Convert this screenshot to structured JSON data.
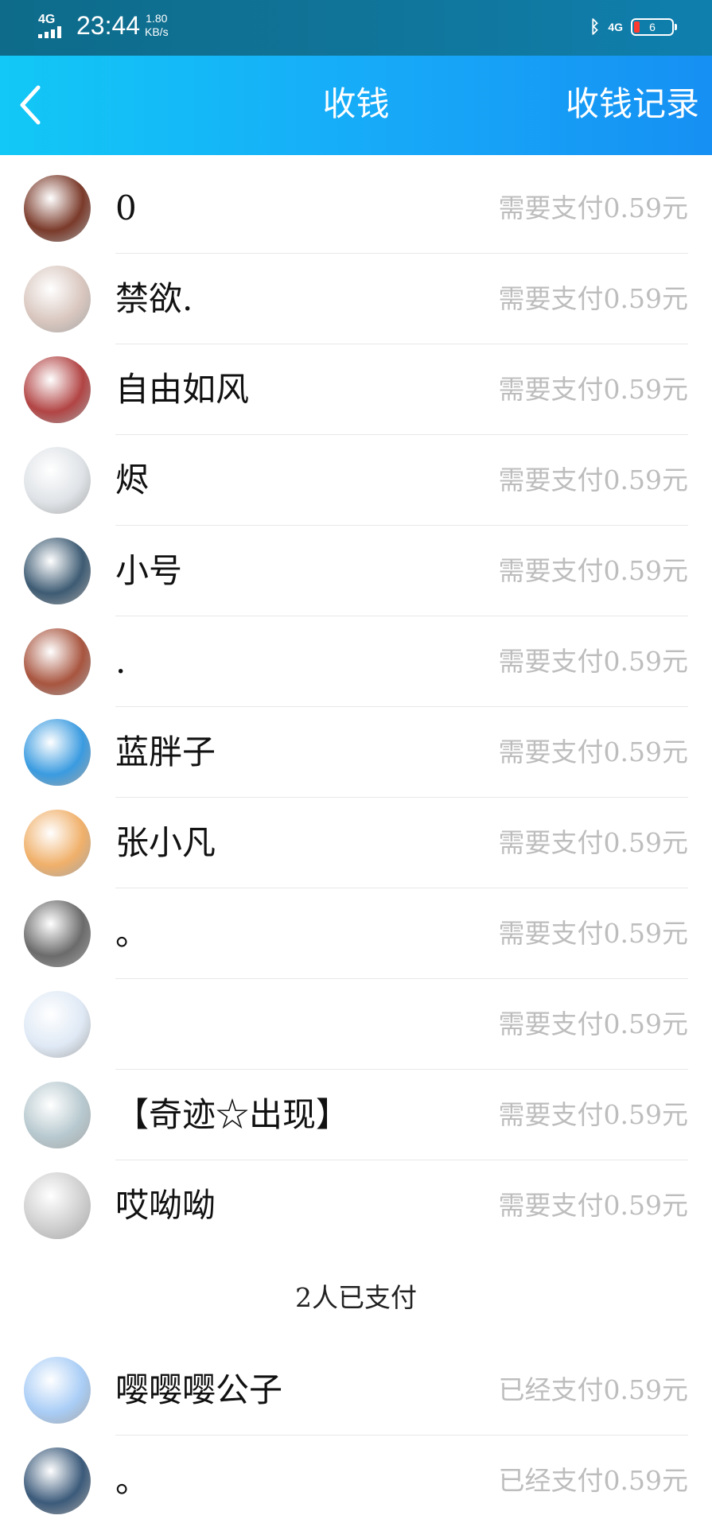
{
  "status_bar": {
    "network": "4G",
    "time": "23:44",
    "speed_value": "1.80",
    "speed_unit": "KB/s",
    "right_network": "4G",
    "battery": "6",
    "icons": [
      "signal-icon",
      "bluetooth-icon",
      "battery-icon"
    ]
  },
  "header": {
    "back_icon": "chevron-left-icon",
    "title": "收钱",
    "records_label": "收钱记录"
  },
  "unpaid": [
    {
      "name": "0",
      "amount_label": "需要支付0.59元",
      "avatar_color": "#7a3a2a"
    },
    {
      "name": "禁欲.",
      "amount_label": "需要支付0.59元",
      "avatar_color": "#d9c7bf"
    },
    {
      "name": "自由如风",
      "amount_label": "需要支付0.59元",
      "avatar_color": "#b24444"
    },
    {
      "name": "烬",
      "amount_label": "需要支付0.59元",
      "avatar_color": "#dfe3e7"
    },
    {
      "name": "小号",
      "amount_label": "需要支付0.59元",
      "avatar_color": "#3d5b73"
    },
    {
      "name": ".",
      "amount_label": "需要支付0.59元",
      "avatar_color": "#a8553f"
    },
    {
      "name": "蓝胖子",
      "amount_label": "需要支付0.59元",
      "avatar_color": "#3a9be0"
    },
    {
      "name": "张小凡",
      "amount_label": "需要支付0.59元",
      "avatar_color": "#f0b06a"
    },
    {
      "name": "。",
      "amount_label": "需要支付0.59元",
      "avatar_color": "#6b6b6b"
    },
    {
      "name": "",
      "amount_label": "需要支付0.59元",
      "avatar_color": "#dfe9f5"
    },
    {
      "name": "【奇迹☆出现】",
      "amount_label": "需要支付0.59元",
      "avatar_color": "#b7c9cf"
    },
    {
      "name": "哎呦呦",
      "amount_label": "需要支付0.59元",
      "avatar_color": "#cfcfcf"
    }
  ],
  "paid_header": "2人已支付",
  "paid": [
    {
      "name": "嘤嘤嘤公子",
      "amount_label": "已经支付0.59元",
      "avatar_color": "#a9cdf6"
    },
    {
      "name": "。",
      "amount_label": "已经支付0.59元",
      "avatar_color": "#3b5a7a"
    }
  ]
}
